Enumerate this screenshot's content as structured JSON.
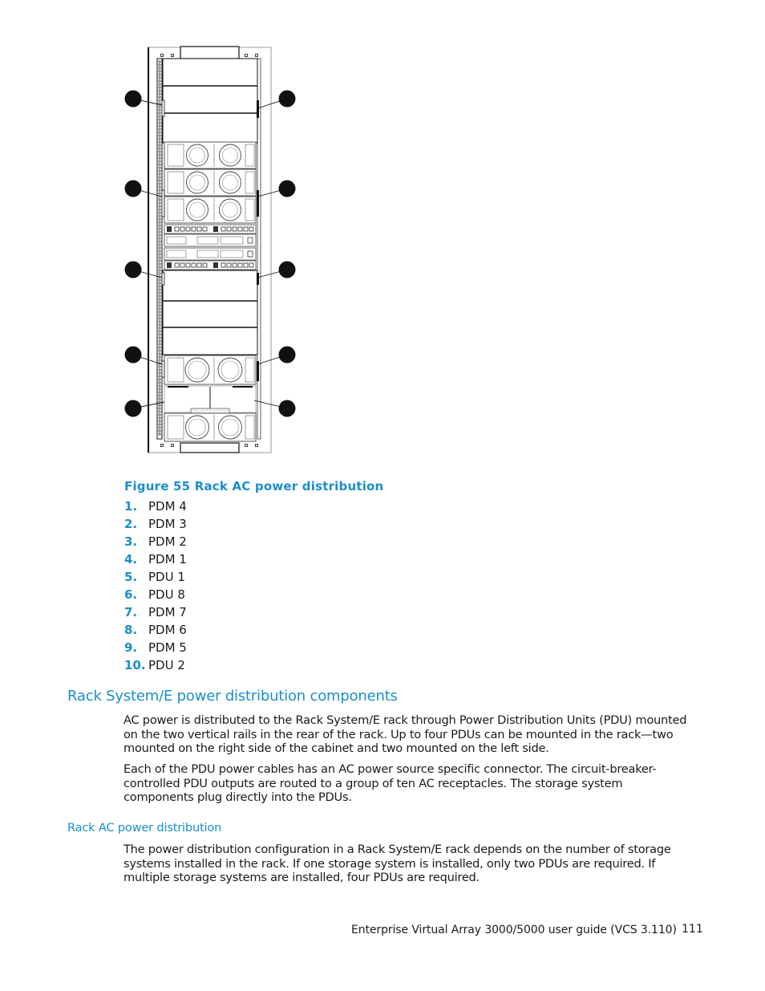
{
  "figure": {
    "caption": "Figure 55 Rack AC power distribution",
    "callout_count": 10,
    "legend": [
      {
        "num": "1.",
        "label": "PDM 4"
      },
      {
        "num": "2.",
        "label": "PDM 3"
      },
      {
        "num": "3.",
        "label": "PDM 2"
      },
      {
        "num": "4.",
        "label": "PDM 1"
      },
      {
        "num": "5.",
        "label": "PDU 1"
      },
      {
        "num": "6.",
        "label": "PDU 8"
      },
      {
        "num": "7.",
        "label": "PDM 7"
      },
      {
        "num": "8.",
        "label": "PDM 6"
      },
      {
        "num": "9.",
        "label": "PDM 5"
      },
      {
        "num": "10.",
        "label": "PDU 2"
      }
    ]
  },
  "section": {
    "heading": "Rack System/E power distribution components",
    "paragraphs": [
      "AC power is distributed to the Rack System/E rack through Power Distribution Units (PDU) mounted on the two vertical rails in the rear of the rack.  Up to four PDUs can be mounted in the rack—two mounted on the right side of the cabinet and two mounted on the left side.",
      "Each of the PDU power cables has an AC power source specific connector.  The circuit-breaker-controlled PDU outputs are routed to a group of ten AC receptacles.  The storage system components plug directly into the PDUs."
    ]
  },
  "subsection": {
    "heading": "Rack AC power distribution",
    "paragraph": "The power distribution configuration in a Rack System/E rack depends on the number of storage systems installed in the rack.  If one storage system is installed, only two PDUs are required.  If multiple storage systems are installed, four PDUs are required."
  },
  "footer": {
    "title": "Enterprise Virtual Array 3000/5000 user guide (VCS 3.110)",
    "page_number": "111"
  },
  "colors": {
    "accent": "#1a8fc9",
    "text": "#1a1a1a"
  }
}
